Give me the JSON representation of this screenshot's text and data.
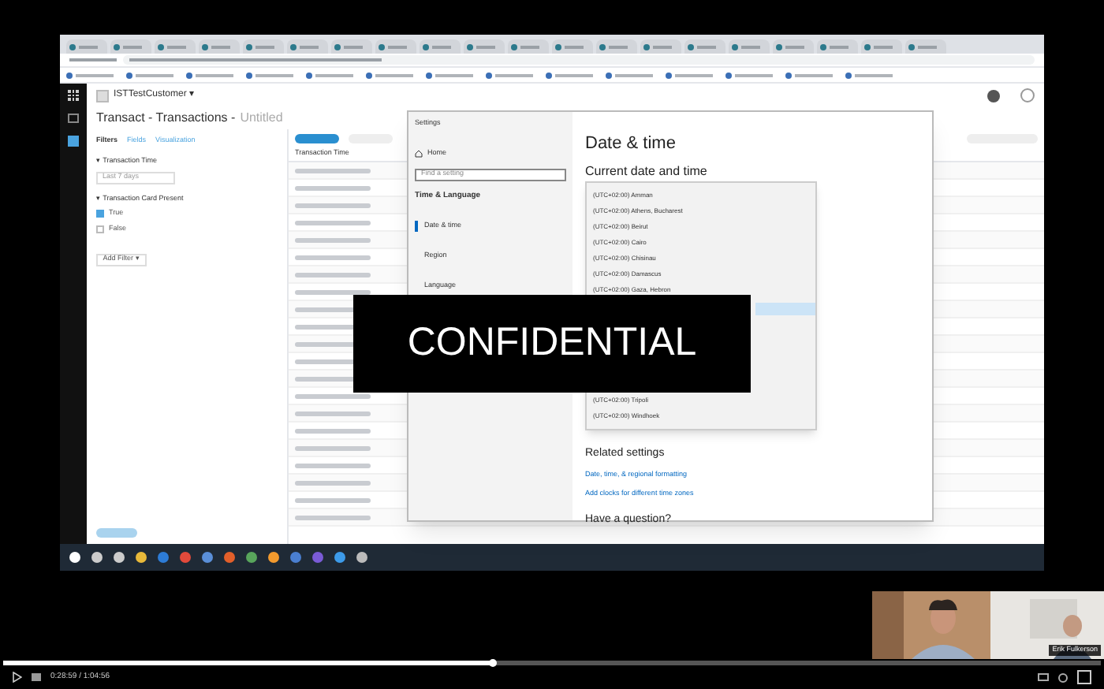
{
  "recording": {
    "account": "ISTTestCustomer",
    "account_caret": "▾",
    "title": "Transact - Transactions -",
    "title_suffix": "Untitled",
    "panel_tabs": [
      {
        "label": "Filters",
        "selected": true
      },
      {
        "label": "Fields",
        "selected": false
      },
      {
        "label": "Visualization",
        "selected": false
      }
    ],
    "filters": [
      {
        "caret": "▾",
        "label": "Transaction Time",
        "select": "Last 7 days"
      },
      {
        "caret": "▾",
        "label": "Transaction Card Present",
        "options": [
          {
            "label": "True",
            "checked": true
          },
          {
            "label": "False",
            "checked": false
          }
        ]
      }
    ],
    "add_filter": "Add Filter",
    "add_filter_caret": "▾",
    "table": {
      "columns": [
        "Transaction Time"
      ]
    },
    "settings": {
      "title": "Settings",
      "home": "Home",
      "search_placeholder": "Find a setting",
      "section": "Time & Language",
      "nav": [
        {
          "label": "Date & time",
          "selected": true
        },
        {
          "label": "Region",
          "selected": false
        },
        {
          "label": "Language",
          "selected": false
        }
      ],
      "heading": "Date & time",
      "subheading": "Current date and time",
      "timezones_above": [
        "(UTC+02:00) Amman",
        "(UTC+02:00) Athens, Bucharest",
        "(UTC+02:00) Beirut",
        "(UTC+02:00) Cairo",
        "(UTC+02:00) Chisinau",
        "(UTC+02:00) Damascus",
        "(UTC+02:00) Gaza, Hebron"
      ],
      "timezones_below": [
        "(UTC+02:00) Tripoli",
        "(UTC+02:00) Windhoek"
      ],
      "related": "Related settings",
      "links": [
        "Date, time, & regional formatting",
        "Add clocks for different time zones"
      ],
      "question": "Have a question?"
    }
  },
  "overlay": "CONFIDENTIAL",
  "participant": {
    "name": "Erik Fulkerson"
  },
  "player": {
    "time": "0:28:59 / 1:04:56",
    "level": 0.446
  }
}
